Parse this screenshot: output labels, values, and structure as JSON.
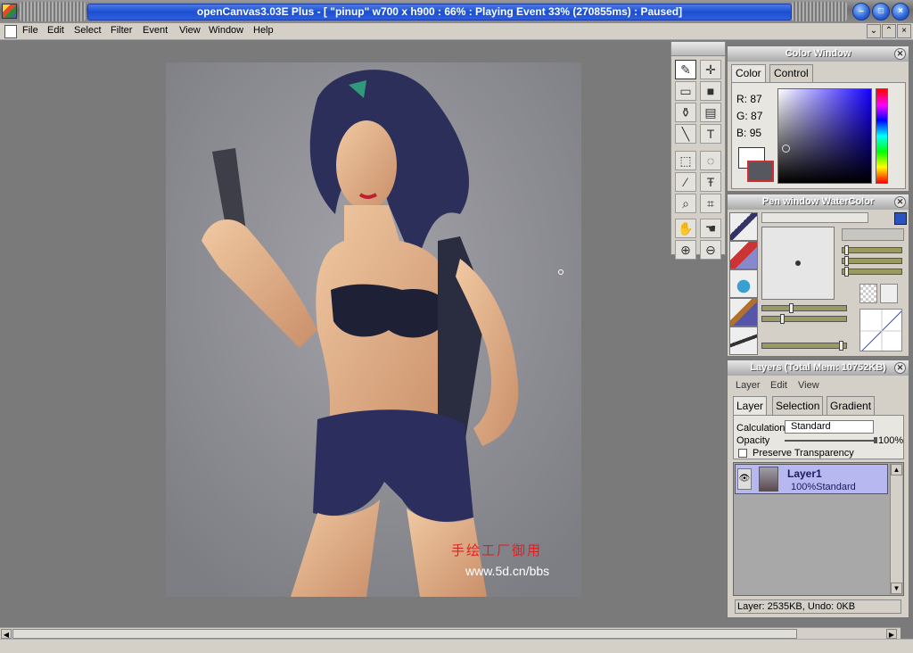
{
  "window": {
    "title": "openCanvas3.03E Plus - [ \"pinup\" w700 x h900 : 66% : Playing Event 33% (270855ms) : Paused]"
  },
  "menu": [
    "File",
    "Edit",
    "Select",
    "Filter",
    "Event",
    "View",
    "Window",
    "Help"
  ],
  "canvas": {
    "watermark_cn": "手绘工厂御用",
    "watermark_url": "www.5d.cn/bbs"
  },
  "tools": [
    {
      "name": "pen-tool-icon",
      "glyph": "✎",
      "selected": true
    },
    {
      "name": "move-tool-icon",
      "glyph": "✛"
    },
    {
      "name": "fill-tool-icon",
      "glyph": "▭"
    },
    {
      "name": "color-swatch-icon",
      "glyph": "■"
    },
    {
      "name": "bucket-tool-icon",
      "glyph": "⚱"
    },
    {
      "name": "gradient-tool-icon",
      "glyph": "▤"
    },
    {
      "name": "line-tool-icon",
      "glyph": "╲"
    },
    {
      "name": "text-tool-icon",
      "glyph": "T"
    },
    {
      "name": "rect-select-icon",
      "glyph": "⬚"
    },
    {
      "name": "lasso-select-icon",
      "glyph": "◌"
    },
    {
      "name": "magic-wand-icon",
      "glyph": "⁄"
    },
    {
      "name": "text-select-icon",
      "glyph": "Ŧ"
    },
    {
      "name": "eyedropper-icon",
      "glyph": "⌕"
    },
    {
      "name": "crop-icon",
      "glyph": "⌗"
    },
    {
      "name": "hand-tool-icon",
      "glyph": "✋"
    },
    {
      "name": "rotate-hand-icon",
      "glyph": "☚"
    },
    {
      "name": "zoom-in-icon",
      "glyph": "⊕"
    },
    {
      "name": "zoom-out-icon",
      "glyph": "⊖"
    }
  ],
  "color_window": {
    "title": "Color Window",
    "tabs": [
      "Color",
      "Control"
    ],
    "r_label": "R:",
    "r": "87",
    "g_label": "G:",
    "g": "87",
    "b_label": "B:",
    "b": "95",
    "fg_color": "#57575f",
    "bg_color": "#ffffff"
  },
  "pen_window": {
    "title": "Pen window  WaterColor"
  },
  "layers_window": {
    "title": "Layers (Total Mem: 10752KB)",
    "menu": [
      "Layer",
      "Edit",
      "View"
    ],
    "tabs": [
      "Layer",
      "Selection",
      "Gradient"
    ],
    "calculation_label": "Calculation",
    "calculation_value": "Standard",
    "opacity_label": "Opacity",
    "opacity_value": "100%",
    "preserve_label": "Preserve Transparency",
    "layer_name": "Layer1",
    "layer_info": "100%Standard",
    "status": "Layer: 2535KB, Undo: 0KB"
  },
  "colors": {
    "title_blue": "#1c4fd0",
    "panel_bg": "#d4d0c8",
    "workspace": "#7a7a7a",
    "layer_selected": "#b8b8f0"
  }
}
